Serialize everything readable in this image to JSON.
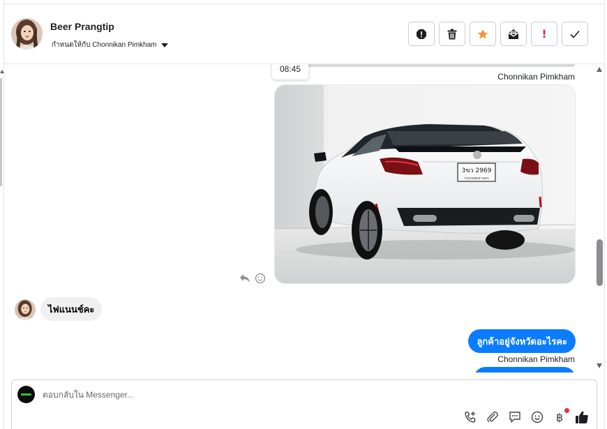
{
  "header": {
    "contact_name": "Beer Prangtip",
    "assigned_label": "กำหนดให้กับ Chonnikan Pimkham",
    "actions": [
      {
        "name": "spam-icon"
      },
      {
        "name": "trash-icon"
      },
      {
        "name": "star-icon",
        "color": "#f7923a"
      },
      {
        "name": "mark-unread-icon"
      },
      {
        "name": "exclamation-icon",
        "color": "#e4264a"
      },
      {
        "name": "check-icon"
      }
    ]
  },
  "thread": {
    "timestamp_tooltip": "08:45",
    "messages": [
      {
        "type": "image",
        "sender": "Chonnikan Pimkham",
        "side": "outgoing",
        "content": "photo-white-sedan"
      },
      {
        "type": "text",
        "side": "incoming",
        "text": "ไฟแนนช์คะ"
      },
      {
        "type": "text",
        "side": "outgoing",
        "text": "ลูกค้าอยู่จังหวัดอะไรคะ",
        "sender": "Chonnikan Pimkham"
      }
    ],
    "license_plate_top": "3ขว 2969",
    "license_plate_bottom": "กรุงเทพมหานคร"
  },
  "composer": {
    "placeholder": "ตอบกลับใน Messenger...",
    "baht_symbol": "฿",
    "tools": [
      "phone-add-icon",
      "paperclip-icon",
      "saved-reply-icon",
      "emoji-icon",
      "baht-icon",
      "thumbs-up-icon"
    ]
  },
  "colors": {
    "outgoing_bubble": "#0a7cff",
    "incoming_bubble": "#f0f0f0",
    "notification_dot": "#f02849"
  }
}
